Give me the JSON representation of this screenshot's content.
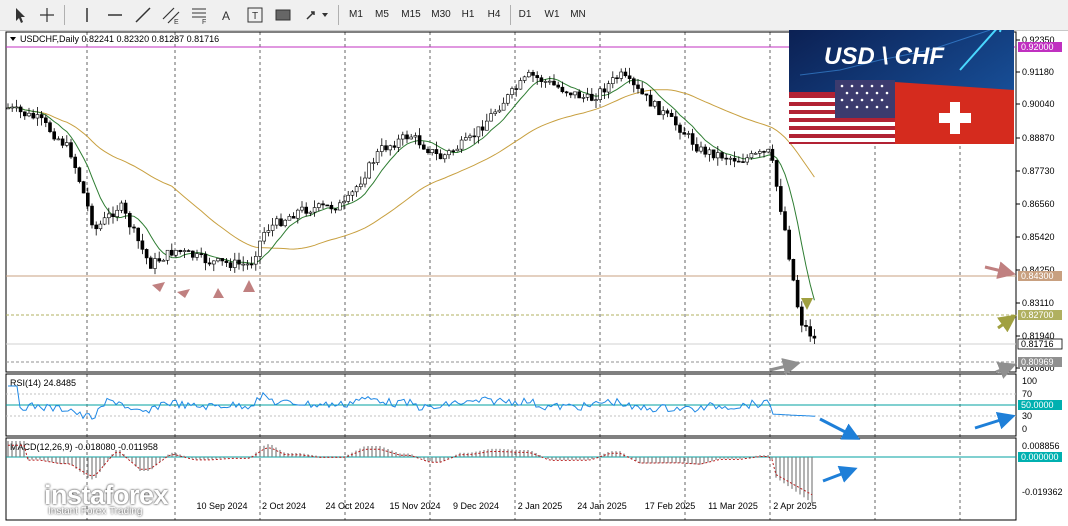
{
  "toolbar": {
    "timeframes": [
      "M1",
      "M5",
      "M15",
      "M30",
      "H1",
      "H4",
      "D1",
      "W1",
      "MN"
    ],
    "tools": [
      "cursor-icon",
      "crosshair-icon",
      "vertical-line-icon",
      "horizontal-line-icon",
      "trendline-icon",
      "channel-icon",
      "fibonacci-icon",
      "text-icon",
      "text-label-icon",
      "rectangle-icon",
      "arrows-icon"
    ]
  },
  "main": {
    "header": "USDCHF,Daily  0.82241 0.82320 0.81287 0.81716",
    "banner_title": "USD \\ CHF",
    "price_ticks": [
      "0.92350",
      "0.91180",
      "0.90040",
      "0.88870",
      "0.87730",
      "0.86560",
      "0.85420",
      "0.84250",
      "0.83110",
      "0.81940",
      "0.80800"
    ],
    "price_tags": {
      "top_line": "0.92000",
      "res_line": "0.84300",
      "target_line": "0.82700",
      "current": "0.81716",
      "support_line": "0.80969"
    },
    "date_labels": [
      "10 Sep 2024",
      "2 Oct 2024",
      "24 Oct 2024",
      "15 Nov 2024",
      "9 Dec 2024",
      "2 Jan 2025",
      "24 Jan 2025",
      "17 Feb 2025",
      "11 Mar 2025",
      "2 Apr 2025"
    ]
  },
  "rsi": {
    "header": "RSI(14) 24.8485",
    "ticks": [
      "100",
      "70",
      "30",
      "0"
    ],
    "tag": "50.0000"
  },
  "macd": {
    "header": "MACD(12,26,9) -0.018080 -0.011958",
    "ticks": [
      "0.008856",
      "-0.019362"
    ],
    "tag": "0.000000"
  },
  "logo": {
    "name": "instaforex",
    "tagline": "Instant Forex Trading"
  },
  "colors": {
    "bull_candle": "#ffffff",
    "bear_candle": "#000000",
    "ma_fast": "#2e7d32",
    "ma_slow": "#c8a040",
    "rsi_line": "#1e88e5",
    "macd_hist": "#808080",
    "signal_line": "#b71c1c",
    "arrow_pink": "#c08080",
    "arrow_olive": "#a0a040",
    "arrow_blue": "#1e7fd8",
    "level_purple": "#c030c0",
    "level_brown": "#c8a080",
    "level_olive": "#b0b060"
  }
}
